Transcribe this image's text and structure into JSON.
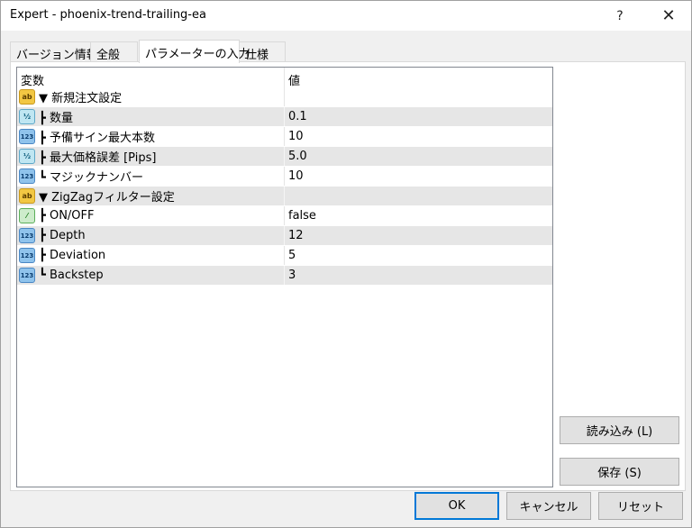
{
  "window": {
    "title": "Expert - phoenix-trend-trailing-ea",
    "help_glyph": "?",
    "close_glyph": "✕"
  },
  "tabs": [
    {
      "label": "バージョン情報",
      "active": false
    },
    {
      "label": "全般",
      "active": false
    },
    {
      "label": "パラメーターの入力",
      "active": true
    },
    {
      "label": "仕様",
      "active": false
    }
  ],
  "grid": {
    "columns": [
      "変数",
      "値"
    ],
    "rows": [
      {
        "icon": "string-icon",
        "icon_text": "ab",
        "name": "▼ 新規注文設定",
        "value": ""
      },
      {
        "icon": "double-icon",
        "icon_text": "½",
        "name": "┣ 数量",
        "value": "0.1"
      },
      {
        "icon": "integer-icon",
        "icon_text": "123",
        "name": "┣ 予備サイン最大本数",
        "value": "10"
      },
      {
        "icon": "double-icon",
        "icon_text": "½",
        "name": "┣ 最大価格誤差 [Pips]",
        "value": "5.0"
      },
      {
        "icon": "integer-icon",
        "icon_text": "123",
        "name": "┗ マジックナンバー",
        "value": "10"
      },
      {
        "icon": "string-icon",
        "icon_text": "ab",
        "name": "▼ ZigZagフィルター設定",
        "value": ""
      },
      {
        "icon": "bool-icon",
        "icon_text": "⁄",
        "name": "┣ ON/OFF",
        "value": "false"
      },
      {
        "icon": "integer-icon",
        "icon_text": "123",
        "name": "┣ Depth",
        "value": "12"
      },
      {
        "icon": "integer-icon",
        "icon_text": "123",
        "name": "┣ Deviation",
        "value": "5"
      },
      {
        "icon": "integer-icon",
        "icon_text": "123",
        "name": "┗ Backstep",
        "value": "3"
      }
    ]
  },
  "buttons": {
    "load": "読み込み (L)",
    "save": "保存 (S)",
    "ok": "OK",
    "cancel": "キャンセル",
    "reset": "リセット"
  }
}
